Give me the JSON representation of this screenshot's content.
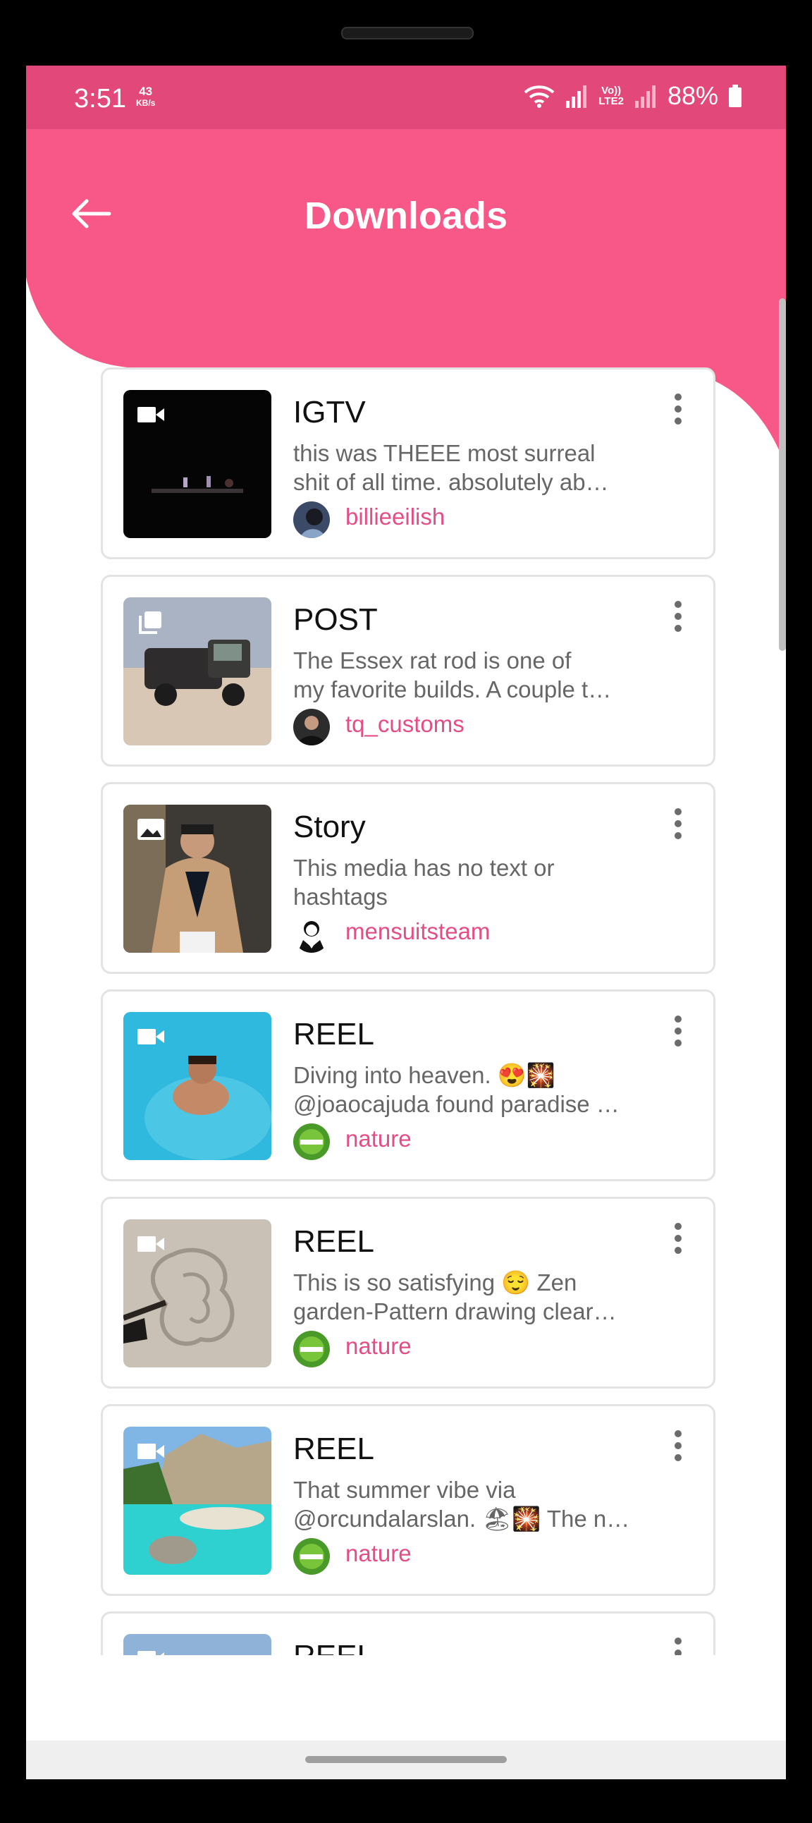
{
  "status": {
    "time": "3:51",
    "speed_value": "43",
    "speed_unit": "KB/s",
    "lte_top": "Vo))",
    "lte_bottom": "LTE2",
    "battery": "88%"
  },
  "header": {
    "title": "Downloads",
    "color": "#f75887"
  },
  "cards": [
    {
      "type": "IGTV",
      "caption_line1": "this was THEEE most surreal",
      "caption_line2": "shit of all time. absolutely ab…",
      "user": "billieeilish",
      "icon": "video-icon"
    },
    {
      "type": "POST",
      "caption_line1": "The Essex rat rod is one of",
      "caption_line2": "my favorite builds. A couple t…",
      "user": "tq_customs",
      "icon": "carousel-icon"
    },
    {
      "type": "Story",
      "caption_line1": "This media has no text or",
      "caption_line2": "hashtags",
      "user": "mensuitsteam",
      "icon": "image-icon"
    },
    {
      "type": "REEL",
      "caption_line1": "Diving into heaven. 😍🎇",
      "caption_line2": "@joaocajuda found paradise …",
      "user": "nature",
      "icon": "video-icon"
    },
    {
      "type": "REEL",
      "caption_line1": "This is so satisfying 😌 Zen",
      "caption_line2": "garden-Pattern drawing clear…",
      "user": "nature",
      "icon": "video-icon"
    },
    {
      "type": "REEL",
      "caption_line1": "That summer vibe via",
      "caption_line2": "@orcundalarslan. 🏖🎇 The n…",
      "user": "nature",
      "icon": "video-icon"
    },
    {
      "type": "REEL",
      "caption_line1": "",
      "caption_line2": "",
      "user": "",
      "icon": "video-icon"
    }
  ],
  "colors": {
    "accent": "#e54d86",
    "status_bar": "#e2497a"
  }
}
